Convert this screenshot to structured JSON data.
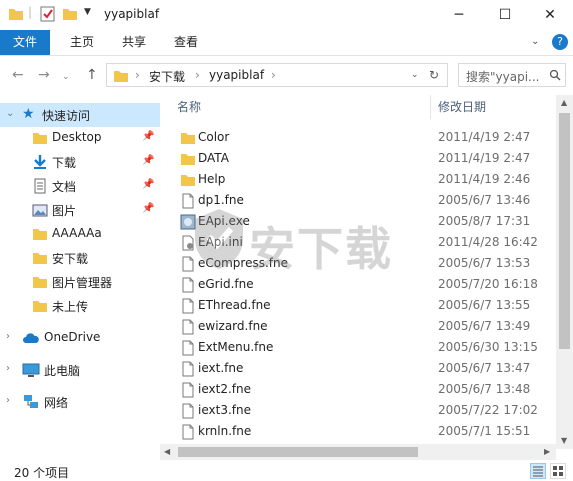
{
  "window": {
    "title": "yyapiblaf",
    "minimize": "─",
    "maximize": "☐",
    "close": "✕"
  },
  "ribbon": {
    "tabs": [
      "文件",
      "主页",
      "共享",
      "查看"
    ],
    "expand_icon": "chevron-down-icon",
    "help": "?"
  },
  "address": {
    "crumbs": [
      "安下载",
      "yyapiblaf"
    ],
    "search_placeholder": "搜索\"yyapi...",
    "refresh_icon": "refresh-icon"
  },
  "sidebar": {
    "quick_access": "快速访问",
    "items": [
      {
        "label": "Desktop",
        "pinned": true,
        "icon": "folder-icon"
      },
      {
        "label": "下载",
        "pinned": true,
        "icon": "download-icon"
      },
      {
        "label": "文档",
        "pinned": true,
        "icon": "document-icon"
      },
      {
        "label": "图片",
        "pinned": true,
        "icon": "picture-icon"
      },
      {
        "label": "AAAAAa",
        "pinned": false,
        "icon": "folder-icon"
      },
      {
        "label": "安下载",
        "pinned": false,
        "icon": "folder-icon"
      },
      {
        "label": "图片管理器",
        "pinned": false,
        "icon": "folder-icon"
      },
      {
        "label": "未上传",
        "pinned": false,
        "icon": "folder-icon"
      }
    ],
    "onedrive": "OneDrive",
    "this_pc": "此电脑",
    "network": "网络"
  },
  "list": {
    "col_name": "名称",
    "col_date": "修改日期",
    "rows": [
      {
        "name": "Color",
        "date": "2011/4/19 2:47",
        "type": "folder"
      },
      {
        "name": "DATA",
        "date": "2011/4/19 2:47",
        "type": "folder"
      },
      {
        "name": "Help",
        "date": "2011/4/19 2:46",
        "type": "folder"
      },
      {
        "name": "dp1.fne",
        "date": "2005/6/7 13:46",
        "type": "file"
      },
      {
        "name": "EApi.exe",
        "date": "2005/8/7 17:31",
        "type": "exe"
      },
      {
        "name": "EApi.ini",
        "date": "2011/4/28 16:42",
        "type": "ini"
      },
      {
        "name": "eCompress.fne",
        "date": "2005/6/7 13:53",
        "type": "file"
      },
      {
        "name": "eGrid.fne",
        "date": "2005/7/20 16:18",
        "type": "file"
      },
      {
        "name": "EThread.fne",
        "date": "2005/6/7 13:55",
        "type": "file"
      },
      {
        "name": "ewizard.fne",
        "date": "2005/6/7 13:49",
        "type": "file"
      },
      {
        "name": "ExtMenu.fne",
        "date": "2005/6/30 13:15",
        "type": "file"
      },
      {
        "name": "iext.fne",
        "date": "2005/6/7 13:47",
        "type": "file"
      },
      {
        "name": "iext2.fne",
        "date": "2005/6/7 13:48",
        "type": "file"
      },
      {
        "name": "iext3.fne",
        "date": "2005/7/22 17:02",
        "type": "file"
      },
      {
        "name": "krnln.fne",
        "date": "2005/7/1 15:51",
        "type": "file"
      }
    ]
  },
  "status": {
    "count": "20 个项目"
  },
  "watermark": "安下载",
  "colors": {
    "accent": "#1979ca",
    "selection": "#cce8ff",
    "folder": "#f2c54b"
  }
}
